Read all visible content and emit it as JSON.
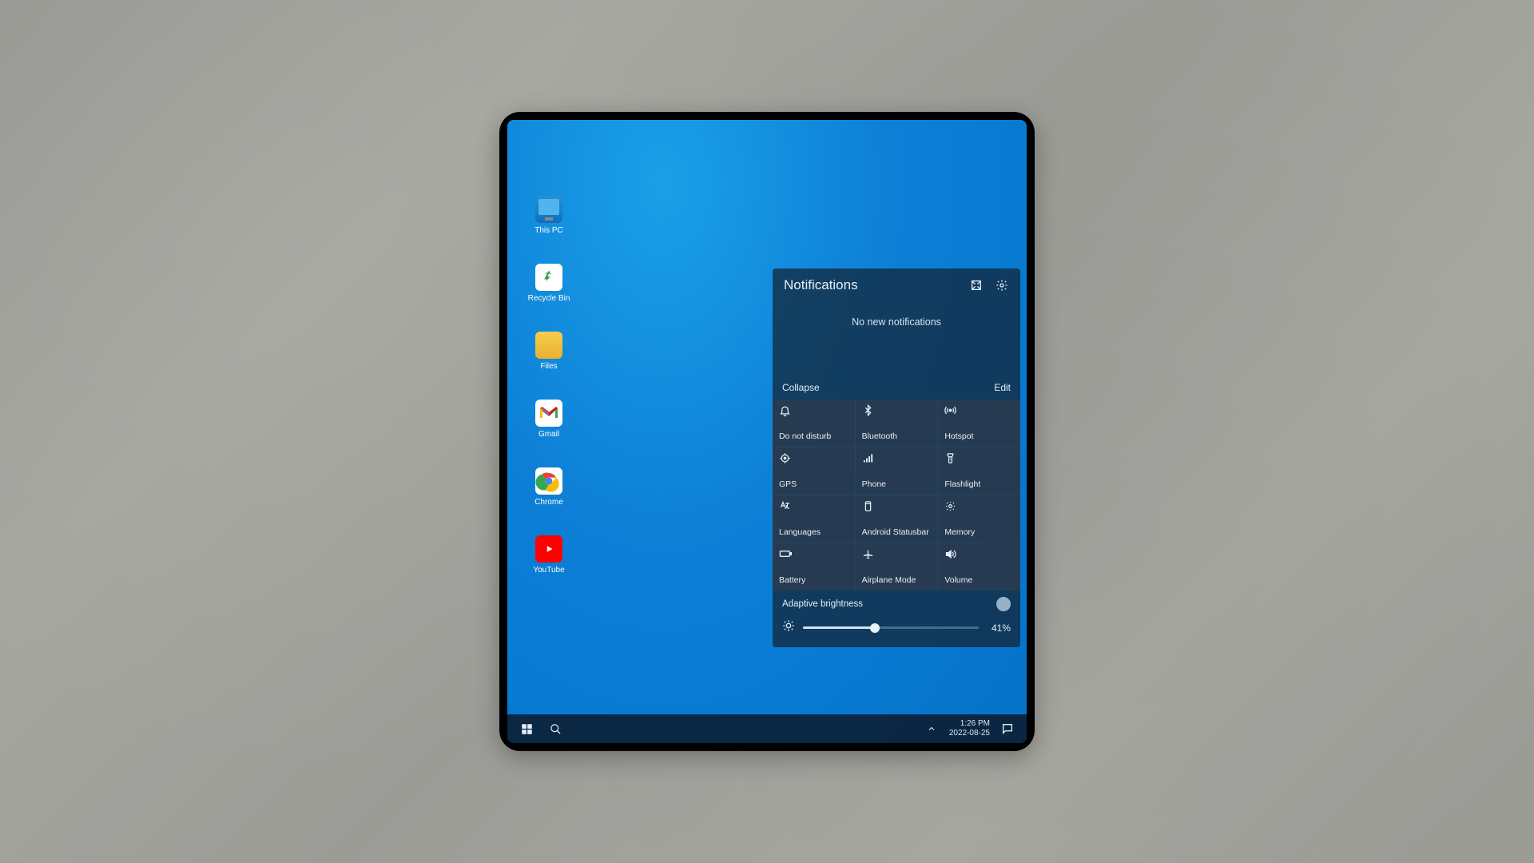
{
  "desktop": {
    "icons": [
      {
        "label": "This PC"
      },
      {
        "label": "Recycle Bin"
      },
      {
        "label": "Files"
      },
      {
        "label": "Gmail"
      },
      {
        "label": "Chrome"
      },
      {
        "label": "YouTube"
      }
    ]
  },
  "panel": {
    "title": "Notifications",
    "empty_msg": "No new notifications",
    "collapse": "Collapse",
    "edit": "Edit",
    "tiles": [
      {
        "label": "Do not disturb",
        "icon": "bell-icon"
      },
      {
        "label": "Bluetooth",
        "icon": "bluetooth-icon"
      },
      {
        "label": "Hotspot",
        "icon": "hotspot-icon"
      },
      {
        "label": "GPS",
        "icon": "gps-icon"
      },
      {
        "label": "Phone",
        "icon": "signal-icon"
      },
      {
        "label": "Flashlight",
        "icon": "flashlight-icon"
      },
      {
        "label": "Languages",
        "icon": "language-icon"
      },
      {
        "label": "Android Statusbar",
        "icon": "statusbar-icon"
      },
      {
        "label": "Memory",
        "icon": "gear-icon"
      },
      {
        "label": "Battery",
        "icon": "battery-icon"
      },
      {
        "label": "Airplane Mode",
        "icon": "airplane-icon"
      },
      {
        "label": "Volume",
        "icon": "volume-icon"
      }
    ],
    "brightness_label": "Adaptive brightness",
    "brightness_pct": "41%",
    "brightness_val": 41
  },
  "taskbar": {
    "time": "1:26 PM",
    "date": "2022-08-25"
  }
}
